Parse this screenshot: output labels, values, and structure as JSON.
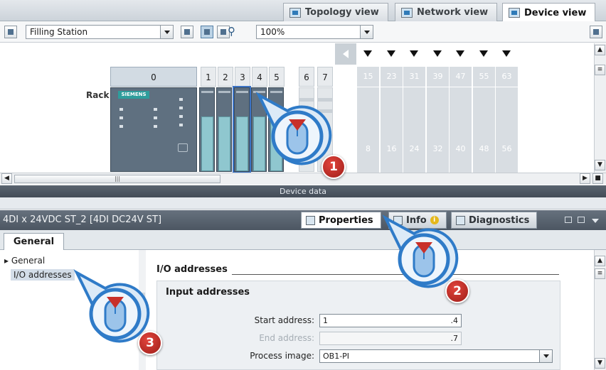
{
  "view_tabs": [
    {
      "label": "Topology view",
      "icon": "topology-icon"
    },
    {
      "label": "Network view",
      "icon": "network-icon"
    },
    {
      "label": "Device view",
      "icon": "device-icon",
      "active": true
    }
  ],
  "toolbar": {
    "device_selector": "Filling Station",
    "zoom": "100%"
  },
  "rack": {
    "label": "Rack",
    "slot_numbers": [
      "0",
      "1",
      "2",
      "3",
      "4",
      "5",
      "6",
      "7"
    ],
    "cpu_brand": "SIEMENS",
    "expansion_heads": [
      "15",
      "23",
      "31",
      "39",
      "47",
      "55",
      "63"
    ],
    "expansion_values": [
      "8",
      "16",
      "24",
      "32",
      "40",
      "48",
      "56"
    ]
  },
  "device_data_label": "Device data",
  "inspector": {
    "title": "4DI x 24VDC ST_2 [4DI DC24V ST]",
    "tabs": [
      {
        "label": "Properties",
        "active": true
      },
      {
        "label": "Info"
      },
      {
        "label": "Diagnostics"
      }
    ],
    "general_tab": "General"
  },
  "nav": {
    "items": [
      "General",
      "I/O addresses"
    ]
  },
  "content": {
    "section_title": "I/O addresses",
    "group_title": "Input addresses",
    "fields": {
      "start_label": "Start address:",
      "start_value": "1",
      "start_suffix": ".4",
      "end_label": "End address:",
      "end_suffix": ".7",
      "pi_label": "Process image:",
      "pi_value": "OB1-PI"
    }
  },
  "callouts": [
    "1",
    "2",
    "3"
  ],
  "colors": {
    "callout_blue": "#2f7bc8",
    "badge_red": "#c8302a",
    "module_face": "#8fc7cf"
  }
}
